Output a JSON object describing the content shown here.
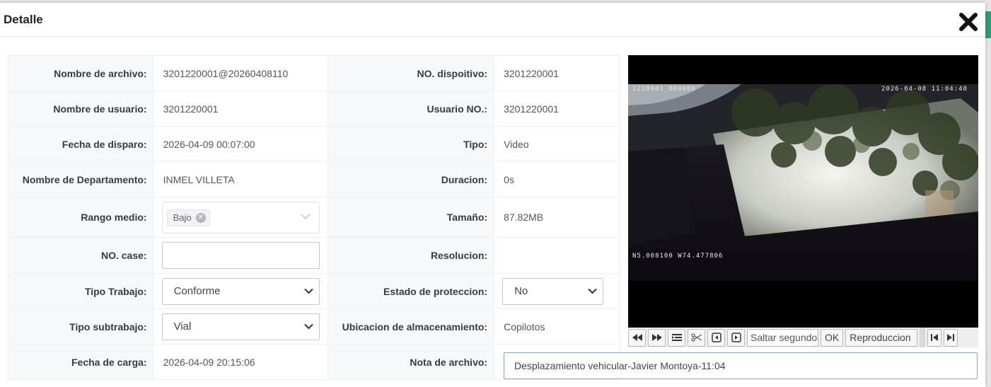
{
  "dialog": {
    "title": "Detalle"
  },
  "fields": {
    "nombre_archivo": {
      "label": "Nombre de archivo",
      "value": "3201220001@20260408110"
    },
    "no_dispositivo": {
      "label": "NO. dispoitivo",
      "value": "3201220001"
    },
    "nombre_usuario": {
      "label": "Nombre de usuario",
      "value": "3201220001"
    },
    "usuario_no": {
      "label": "Usuario NO.",
      "value": "3201220001"
    },
    "fecha_disparo": {
      "label": "Fecha de disparo",
      "value": "2026-04-09 00:07:00"
    },
    "tipo": {
      "label": "Tipo",
      "value": "Video"
    },
    "departamento": {
      "label": "Nombre de Departamento",
      "value": "INMEL VILLETA"
    },
    "duracion": {
      "label": "Duracion",
      "value": "0s"
    },
    "rango_medio": {
      "label": "Rango medio",
      "tag": "Bajo"
    },
    "tamano": {
      "label": "Tamaño",
      "value": "87.82MB"
    },
    "no_case": {
      "label": "NO. case",
      "value": ""
    },
    "resolucion": {
      "label": "Resolucion",
      "value": ""
    },
    "tipo_trabajo": {
      "label": "Tipo Trabajo",
      "value": "Conforme"
    },
    "estado_proteccion": {
      "label": "Estado de proteccion",
      "value": "No"
    },
    "tipo_subtrabajo": {
      "label": "Tipo subtrabajo",
      "value": "Vial"
    },
    "ubicacion": {
      "label": "Ubicacion de almacenamiento",
      "value": "Copilotos"
    },
    "fecha_carga": {
      "label": "Fecha de carga",
      "value": "2026-04-09 20:15:06"
    },
    "nota_archivo": {
      "label": "Nota de archivo",
      "value": "Desplazamiento vehicular-Javier Montoya-11:04"
    }
  },
  "video": {
    "osd_device": "1220001_000000",
    "osd_datetime": "2026-04-08 11:04:40",
    "osd_gps": "N5.008100  W74.477806"
  },
  "player": {
    "seek_placeholder": "Saltar segundo",
    "ok_label": "OK",
    "playback_label": "Reproduccion"
  },
  "colors": {
    "label_bg": "#f7f8fa",
    "border": "#ebeef5",
    "accent": "#2a9d7f"
  }
}
